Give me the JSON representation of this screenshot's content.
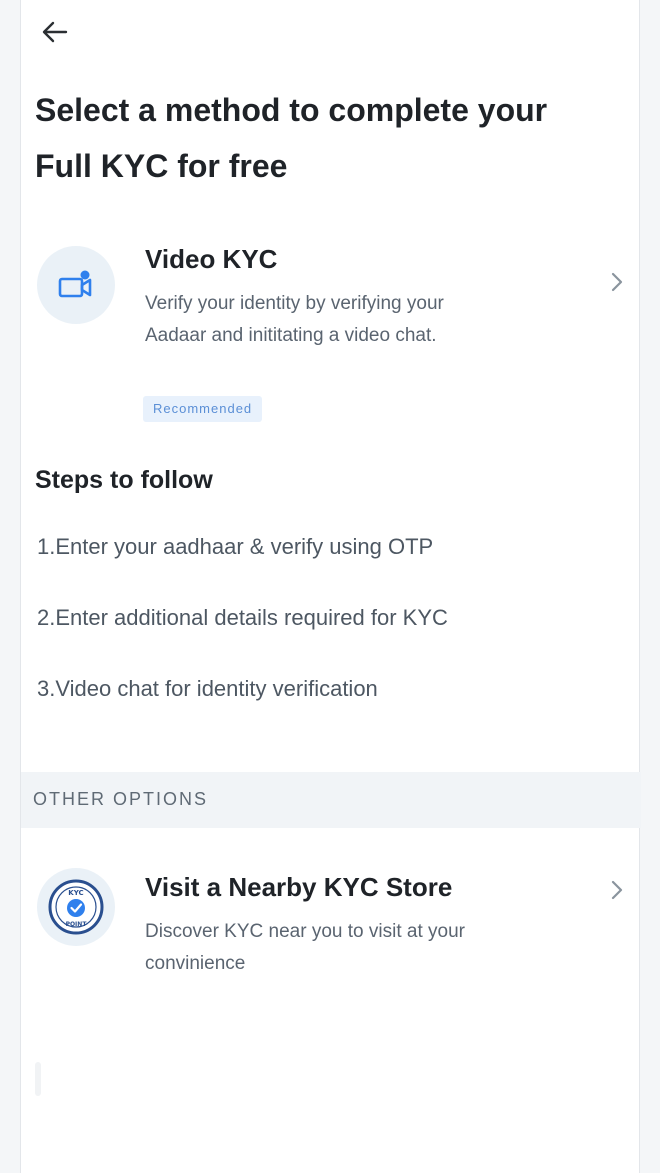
{
  "header": {
    "back_icon": "arrow-left-icon",
    "title": "Select a method to complete your Full KYC for free"
  },
  "video_kyc": {
    "icon": "video-camera-icon",
    "title": "Video KYC",
    "description": "Verify your identity by verifying your Aadaar and inititating a video chat.",
    "badge": "Recommended",
    "chevron_icon": "chevron-right-icon"
  },
  "steps": {
    "title": "Steps to follow",
    "items": [
      "1.Enter your aadhaar & verify using OTP",
      "2.Enter additional details required for KYC",
      "3.Video chat for identity verification"
    ]
  },
  "other_options": {
    "label": "OTHER OPTIONS"
  },
  "kyc_store": {
    "icon": "kyc-point-icon",
    "icon_text_top": "KYC",
    "icon_text_bottom": "POINT",
    "title": "Visit a Nearby KYC Store",
    "description": "Discover KYC near you to visit at your convinience",
    "chevron_icon": "chevron-right-icon"
  },
  "colors": {
    "accent": "#2f80ed",
    "icon_bg": "#eaf1f7",
    "badge_bg": "#e8f1fc",
    "badge_text": "#5b8fd6",
    "band_bg": "#f1f4f7"
  }
}
